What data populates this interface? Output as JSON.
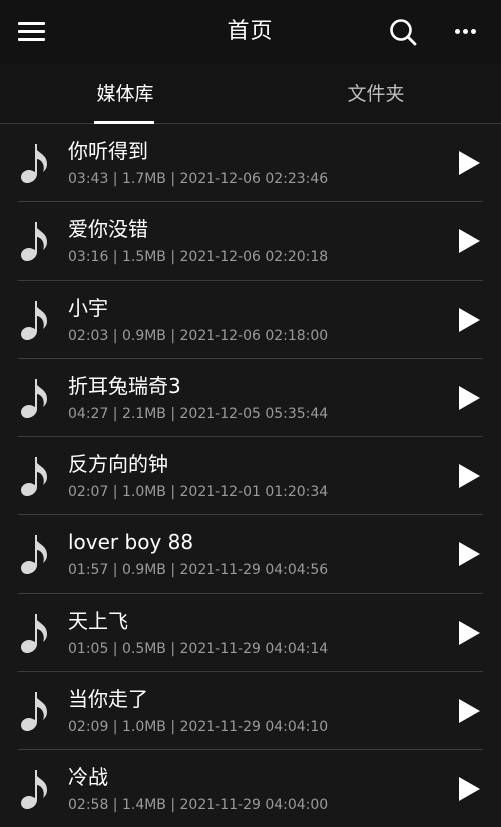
{
  "header": {
    "title": "首页",
    "menu_icon": "hamburger-menu-icon",
    "search_icon": "search-icon",
    "more_icon": "more-dots-icon"
  },
  "tabs": [
    {
      "label": "媒体库",
      "selected": true
    },
    {
      "label": "文件夹",
      "selected": false
    }
  ],
  "colors": {
    "background": "#171717",
    "text_primary": "#ffffff",
    "text_secondary": "#9a9a9a",
    "divider": "#3c3c3c"
  },
  "songs": [
    {
      "title": "你听得到",
      "meta": "03:43 | 1.7MB | 2021-12-06 02:23:46"
    },
    {
      "title": "爱你没错",
      "meta": "03:16 | 1.5MB | 2021-12-06 02:20:18"
    },
    {
      "title": "小宇",
      "meta": "02:03 | 0.9MB | 2021-12-06 02:18:00"
    },
    {
      "title": "折耳兔瑞奇3",
      "meta": "04:27 | 2.1MB | 2021-12-05 05:35:44"
    },
    {
      "title": "反方向的钟",
      "meta": "02:07 | 1.0MB | 2021-12-01 01:20:34"
    },
    {
      "title": "lover boy 88",
      "meta": "01:57 | 0.9MB | 2021-11-29 04:04:56"
    },
    {
      "title": "天上飞",
      "meta": "01:05 | 0.5MB | 2021-11-29 04:04:14"
    },
    {
      "title": "当你走了",
      "meta": "02:09 | 1.0MB | 2021-11-29 04:04:10"
    },
    {
      "title": "冷战",
      "meta": "02:58 | 1.4MB | 2021-11-29 04:04:00"
    }
  ]
}
